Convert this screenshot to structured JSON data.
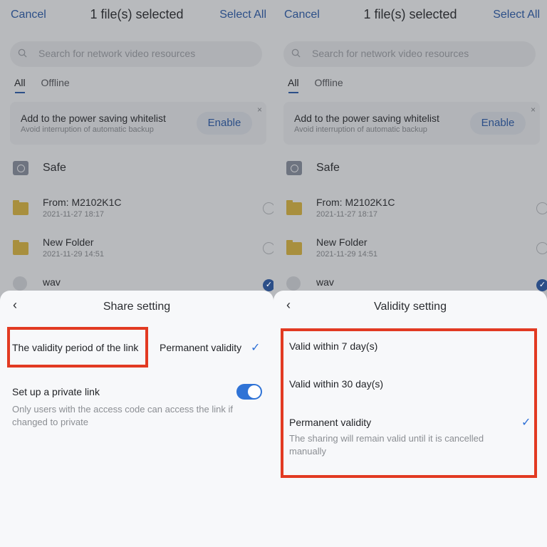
{
  "header": {
    "cancel": "Cancel",
    "title": "1 file(s) selected",
    "select_all": "Select All"
  },
  "search": {
    "placeholder": "Search for network video resources"
  },
  "tabs": [
    {
      "label": "All"
    },
    {
      "label": "Offline"
    }
  ],
  "banner": {
    "title": "Add to the power saving whitelist",
    "subtitle": "Avoid interruption of automatic backup",
    "button": "Enable",
    "close": "×"
  },
  "safe": {
    "label": "Safe"
  },
  "files": [
    {
      "name": "From: M2102K1C",
      "date": "2021-11-27  18:17"
    },
    {
      "name": "New Folder",
      "date": "2021-11-29  14:51"
    },
    {
      "name": "wav",
      "date": ""
    }
  ],
  "share_sheet": {
    "back": "‹",
    "title": "Share setting",
    "validity_label": "The validity period of the link",
    "validity_value": "Permanent validity",
    "private_label": "Set up a private link",
    "private_desc": "Only users with the access code can access the link if changed to private",
    "private_enabled": true
  },
  "validity_sheet": {
    "back": "‹",
    "title": "Validity setting",
    "options": [
      {
        "label": "Valid within 7 day(s)",
        "desc": "",
        "selected": false
      },
      {
        "label": "Valid within 30 day(s)",
        "desc": "",
        "selected": false
      },
      {
        "label": "Permanent validity",
        "desc": "The sharing will remain valid until it is cancelled manually",
        "selected": true
      }
    ]
  },
  "colors": {
    "accent": "#2f73d6",
    "highlight": "#e23a22",
    "link": "#2c4f88"
  }
}
